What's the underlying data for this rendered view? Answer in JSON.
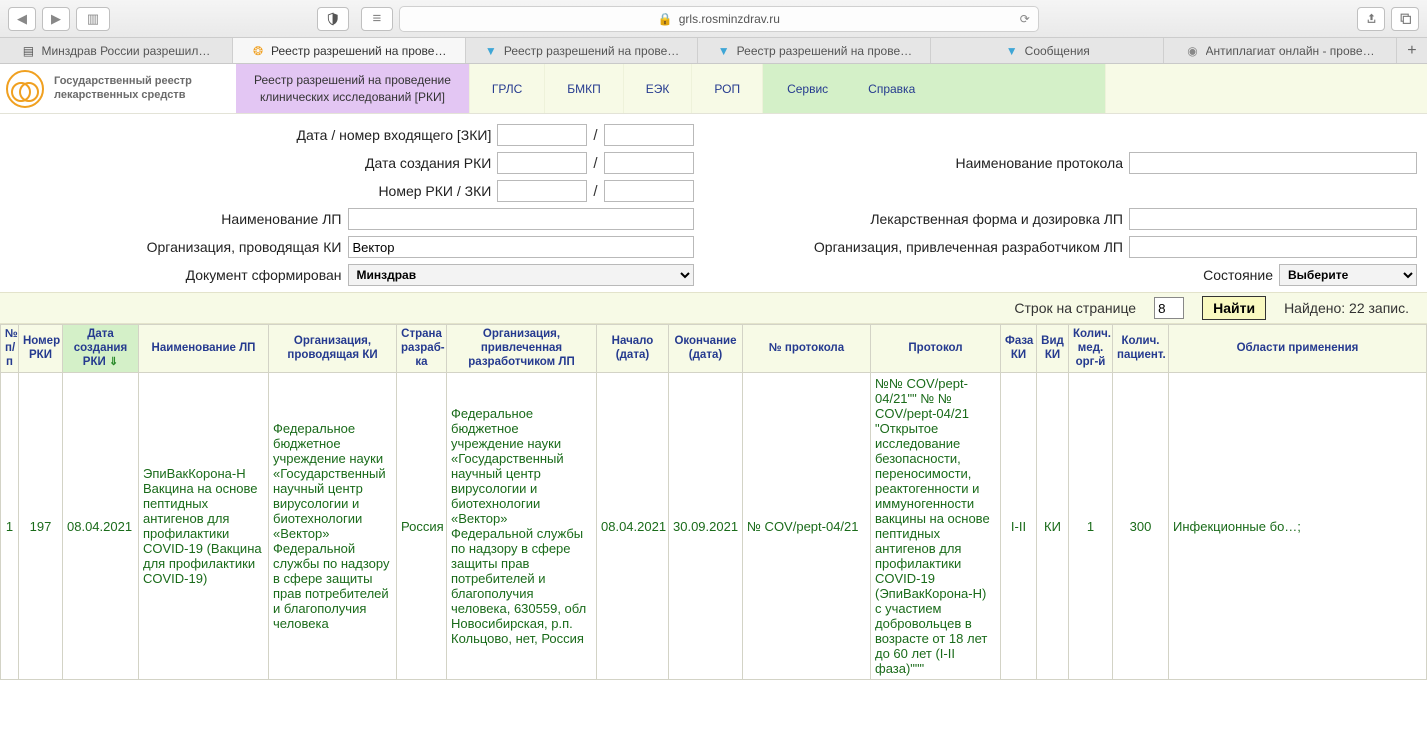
{
  "browser": {
    "url_host": "grls.rosminzdrav.ru",
    "tabs": [
      {
        "label": "Минздрав России разрешил…",
        "icon": "doc"
      },
      {
        "label": "Реестр разрешений на прове…",
        "icon": "sun",
        "active": true
      },
      {
        "label": "Реестр разрешений на прове…",
        "icon": "shield"
      },
      {
        "label": "Реестр разрешений на прове…",
        "icon": "shield"
      },
      {
        "label": "Сообщения",
        "icon": "shield"
      },
      {
        "label": "Антиплагиат онлайн - прове…",
        "icon": "eye"
      }
    ]
  },
  "site": {
    "title_line1": "Государственный реестр",
    "title_line2": "лекарственных средств",
    "nav_active_line1": "Реестр разрешений на проведение",
    "nav_active_line2": "клинических исследований [РКИ]",
    "nav": [
      "ГРЛС",
      "БМКП",
      "ЕЭК",
      "РОП"
    ],
    "nav_service": "Сервис",
    "nav_help": "Справка"
  },
  "form": {
    "l_incoming": "Дата / номер входящего [ЗКИ]",
    "l_created": "Дата создания РКИ",
    "l_rki_zki": "Номер РКИ / ЗКИ",
    "l_lp_name": "Наименование ЛП",
    "l_org_ki": "Организация, проводящая КИ",
    "l_doc_formed": "Документ сформирован",
    "l_protocol_name": "Наименование протокола",
    "l_form_dose": "Лекарственная форма и дозировка ЛП",
    "l_org_dev": "Организация, привлеченная разработчиком ЛП",
    "l_state": "Состояние",
    "v_org_ki": "Вектор",
    "v_doc_formed": "Минздрав",
    "v_state": "Выберите"
  },
  "result_bar": {
    "per_page_label": "Строк на странице",
    "per_page_value": "8",
    "find_label": "Найти",
    "found_label": "Найдено: 22 запис."
  },
  "columns": {
    "c0": "№ п/п",
    "c1": "Номер РКИ",
    "c2": "Дата создания РКИ",
    "c3": "Наименование ЛП",
    "c4": "Организация, проводящая КИ",
    "c5": "Страна разраб-ка",
    "c6": "Организация, привлеченная разработчиком ЛП",
    "c7": "Начало (дата)",
    "c8": "Окончание (дата)",
    "c9": "№ протокола",
    "c10": "Протокол",
    "c11": "Фаза КИ",
    "c12": "Вид КИ",
    "c13": "Колич. мед. орг-й",
    "c14": "Колич. пациент.",
    "c15": "Области применения"
  },
  "rows": [
    {
      "n": "1",
      "rki_no": "197",
      "date": "08.04.2021",
      "lp": "ЭпиВакКорона-Н Вакцина на основе пептидных антигенов для профилактики COVID-19 (Вакцина для профилактики COVID-19)",
      "org_ki": "Федеральное бюджетное учреждение науки «Государственный научный центр вирусологии и биотехнологии «Вектор» Федеральной службы по надзору в сфере защиты прав потребителей и благополучия человека",
      "country": "Россия",
      "org_dev": "Федеральное бюджетное учреждение науки «Государственный научный центр вирусологии и биотехнологии «Вектор» Федеральной службы по надзору в сфере защиты прав потребителей и благополучия человека, 630559, обл Новосибирская, р.п. Кольцово, нет, Россия",
      "start": "08.04.2021",
      "end": "30.09.2021",
      "proto_no": "№ COV/pept-04/21",
      "proto": "№№ COV/pept-04/21\"\" № № COV/pept-04/21 \"Открытое исследование безопасности, переносимости, реактогенности и иммуногенности вакцины на основе пептидных антигенов для профилактики COVID-19 (ЭпиВакКорона-Н) с участием добровольцев в возрасте от 18 лет до 60 лет (I-II фаза)\"\"\"",
      "phase": "I-II",
      "kind": "КИ",
      "orgs": "1",
      "patients": "300",
      "area": "Инфекционные бо…;"
    }
  ]
}
